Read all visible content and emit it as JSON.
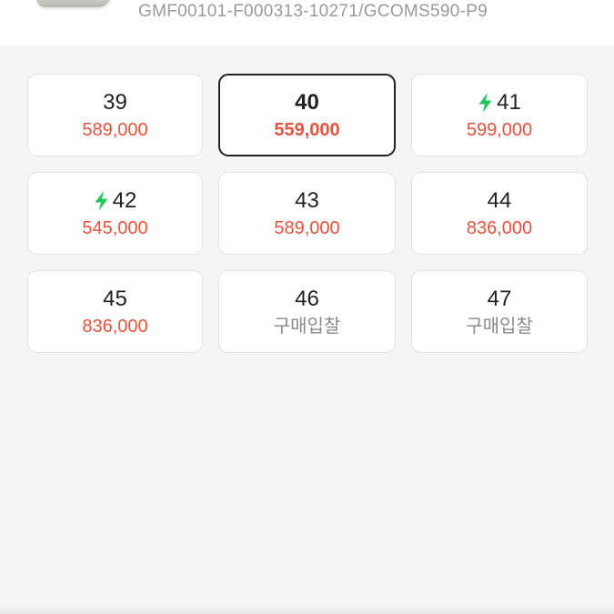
{
  "product": {
    "model_code": "GMF00101-F000313-10271/GCOMS590-P9"
  },
  "size_options": [
    {
      "size": "39",
      "price": "589,000",
      "fast": false,
      "selected": false,
      "bid": false
    },
    {
      "size": "40",
      "price": "559,000",
      "fast": false,
      "selected": true,
      "bid": false
    },
    {
      "size": "41",
      "price": "599,000",
      "fast": true,
      "selected": false,
      "bid": false
    },
    {
      "size": "42",
      "price": "545,000",
      "fast": true,
      "selected": false,
      "bid": false
    },
    {
      "size": "43",
      "price": "589,000",
      "fast": false,
      "selected": false,
      "bid": false
    },
    {
      "size": "44",
      "price": "836,000",
      "fast": false,
      "selected": false,
      "bid": false
    },
    {
      "size": "45",
      "price": "836,000",
      "fast": false,
      "selected": false,
      "bid": false
    },
    {
      "size": "46",
      "price": "구매입찰",
      "fast": false,
      "selected": false,
      "bid": true
    },
    {
      "size": "47",
      "price": "구매입찰",
      "fast": false,
      "selected": false,
      "bid": true
    }
  ],
  "icons": {
    "fast_delivery": "lightning-bolt-icon"
  },
  "colors": {
    "price": "#e5533f",
    "bid_text": "#8a8a8a",
    "bolt": "#22c55e",
    "selected_border": "#222222"
  }
}
